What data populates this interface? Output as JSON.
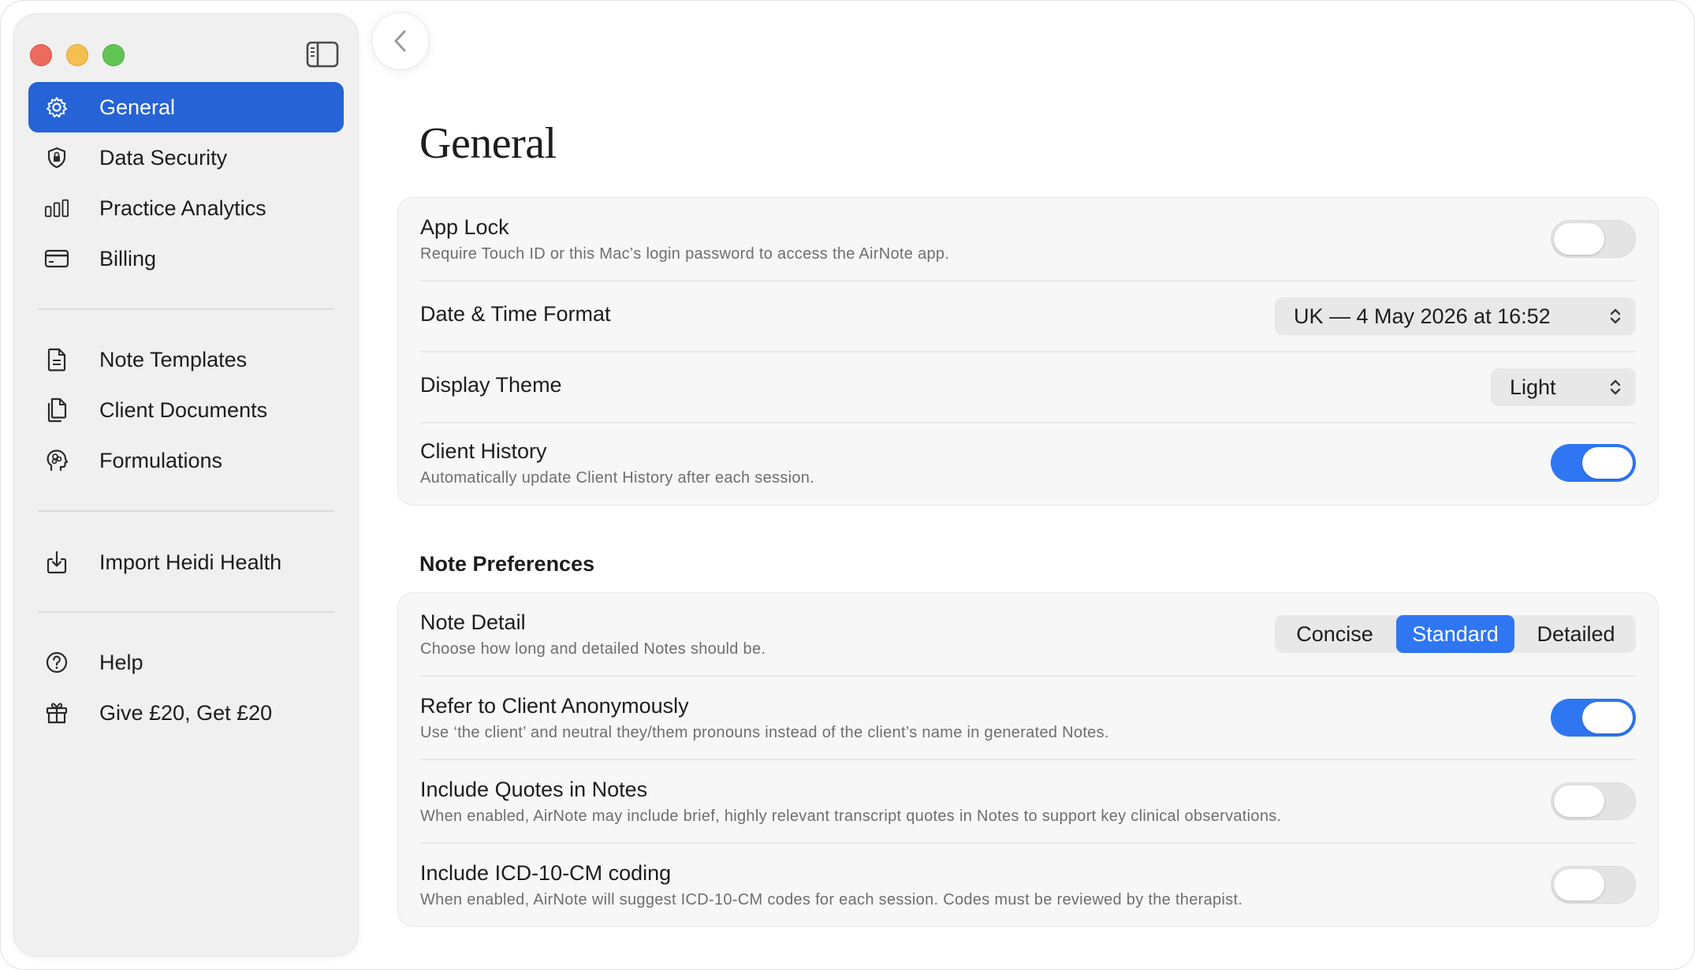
{
  "sidebar": {
    "groups": [
      [
        {
          "label": "General",
          "icon": "gear-icon",
          "active": true
        },
        {
          "label": "Data Security",
          "icon": "shield-icon"
        },
        {
          "label": "Practice Analytics",
          "icon": "bar-chart-icon"
        },
        {
          "label": "Billing",
          "icon": "credit-card-icon"
        }
      ],
      [
        {
          "label": "Note Templates",
          "icon": "document-icon"
        },
        {
          "label": "Client Documents",
          "icon": "documents-icon"
        },
        {
          "label": "Formulations",
          "icon": "head-icon"
        }
      ],
      [
        {
          "label": "Import Heidi Health",
          "icon": "import-icon"
        }
      ],
      [
        {
          "label": "Help",
          "icon": "help-icon"
        },
        {
          "label": "Give £20, Get £20",
          "icon": "gift-icon"
        }
      ]
    ]
  },
  "page": {
    "title": "General"
  },
  "general": {
    "app_lock": {
      "title": "App Lock",
      "description": "Require Touch ID or this Mac’s login password to access the AirNote app.",
      "enabled": false
    },
    "date_time_format": {
      "title": "Date & Time Format",
      "value": "UK — 4 May 2026 at 16:52"
    },
    "display_theme": {
      "title": "Display Theme",
      "value": "Light"
    },
    "client_history": {
      "title": "Client History",
      "description": "Automatically update Client History after each session.",
      "enabled": true
    }
  },
  "note_preferences": {
    "heading": "Note Preferences",
    "note_detail": {
      "title": "Note Detail",
      "description": "Choose how long and detailed Notes should be.",
      "options": [
        "Concise",
        "Standard",
        "Detailed"
      ],
      "selected": "Standard"
    },
    "anonymous": {
      "title": "Refer to Client Anonymously",
      "description": "Use ‘the client’ and neutral they/them pronouns instead of the client’s name in generated Notes.",
      "enabled": true
    },
    "quotes": {
      "title": "Include Quotes in Notes",
      "description": "When enabled, AirNote may include brief, highly relevant transcript quotes in Notes to support key clinical observations.",
      "enabled": false
    },
    "icd": {
      "title": "Include ICD-10-CM coding",
      "description": "When enabled, AirNote will suggest ICD-10-CM codes for each session. Codes must be reviewed by the therapist.",
      "enabled": false
    }
  },
  "colors": {
    "accent": "#2563d6",
    "toggle_on": "#2f77f2"
  }
}
